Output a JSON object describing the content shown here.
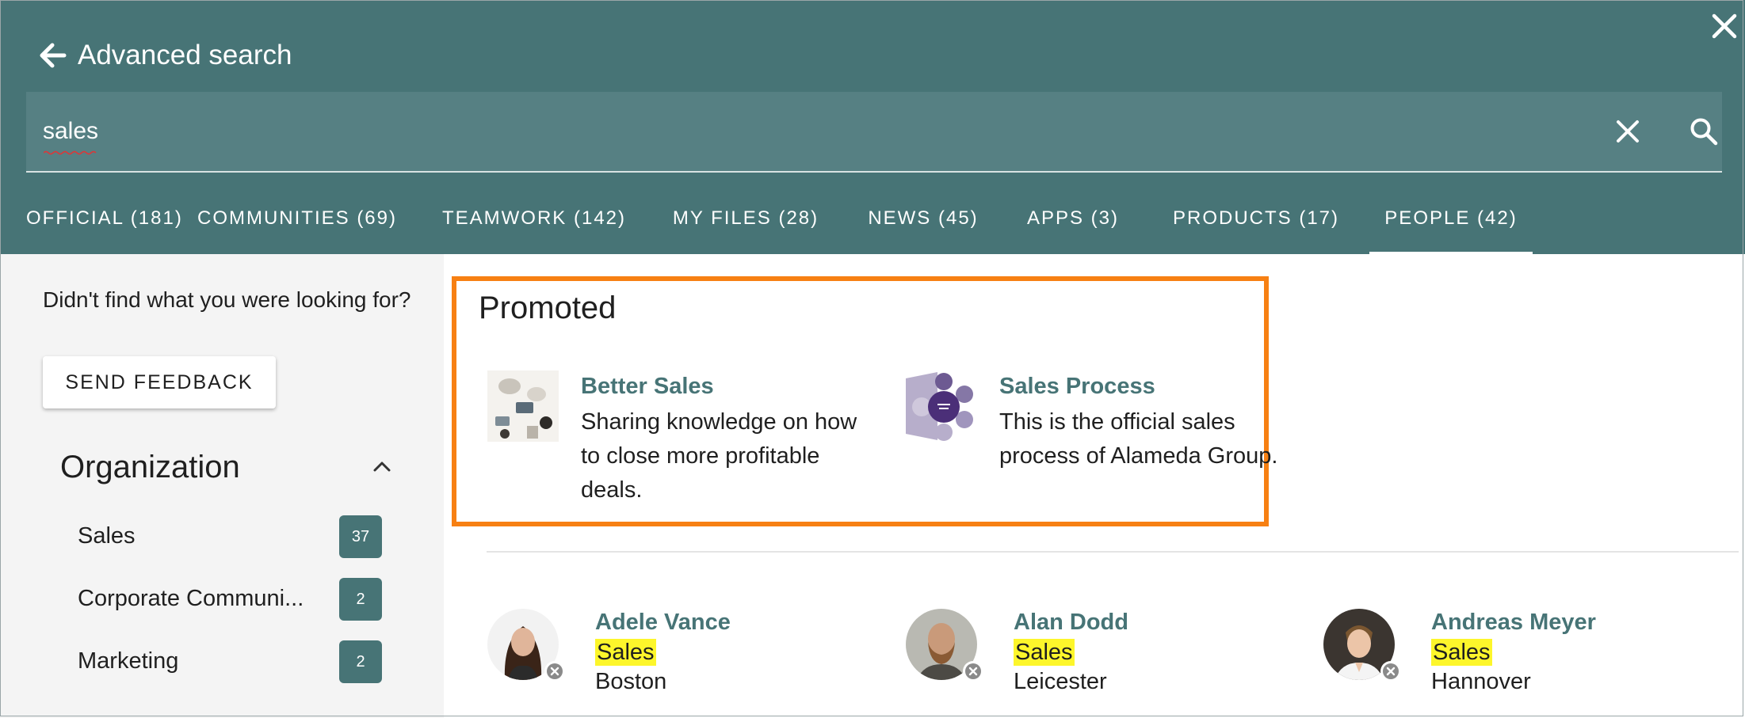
{
  "header": {
    "title": "Advanced search"
  },
  "search": {
    "value": "sales",
    "placeholder": ""
  },
  "tabs": [
    {
      "label": "OFFICIAL (181)",
      "active": false
    },
    {
      "label": "COMMUNITIES (69)",
      "active": false
    },
    {
      "label": "TEAMWORK (142)",
      "active": false
    },
    {
      "label": "MY FILES (28)",
      "active": false
    },
    {
      "label": "NEWS (45)",
      "active": false
    },
    {
      "label": "APPS (3)",
      "active": false
    },
    {
      "label": "PRODUCTS (17)",
      "active": false
    },
    {
      "label": "PEOPLE (42)",
      "active": true
    }
  ],
  "sidebar": {
    "not_found_text": "Didn't find what you were looking for?",
    "feedback_button": "SEND FEEDBACK",
    "org_title": "Organization",
    "facets": [
      {
        "label": "Sales",
        "count": "37"
      },
      {
        "label": "Corporate Communi...",
        "count": "2"
      },
      {
        "label": "Marketing",
        "count": "2"
      }
    ]
  },
  "promoted": {
    "title": "Promoted",
    "items": [
      {
        "title": "Better Sales",
        "description": "Sharing knowledge on how to close more profitable deals."
      },
      {
        "title": "Sales Process",
        "description": "This is the official sales process of Alameda Group."
      }
    ]
  },
  "people": [
    {
      "name": "Adele Vance",
      "department": "Sales",
      "city": "Boston"
    },
    {
      "name": "Alan Dodd",
      "department": "Sales",
      "city": "Leicester"
    },
    {
      "name": "Andreas Meyer",
      "department": "Sales",
      "city": "Hannover"
    }
  ],
  "colors": {
    "header_bg": "#477476",
    "search_bg": "#568083",
    "accent": "#477476",
    "promoted_border": "#f78013",
    "highlight": "#fdf62b",
    "sidebar_bg": "#f4f4f4"
  },
  "icons": {
    "back": "arrow-left-icon",
    "close": "close-icon",
    "clear": "clear-icon",
    "search": "search-icon",
    "collapse": "chevron-up-icon",
    "presence": "presence-offline-icon"
  }
}
